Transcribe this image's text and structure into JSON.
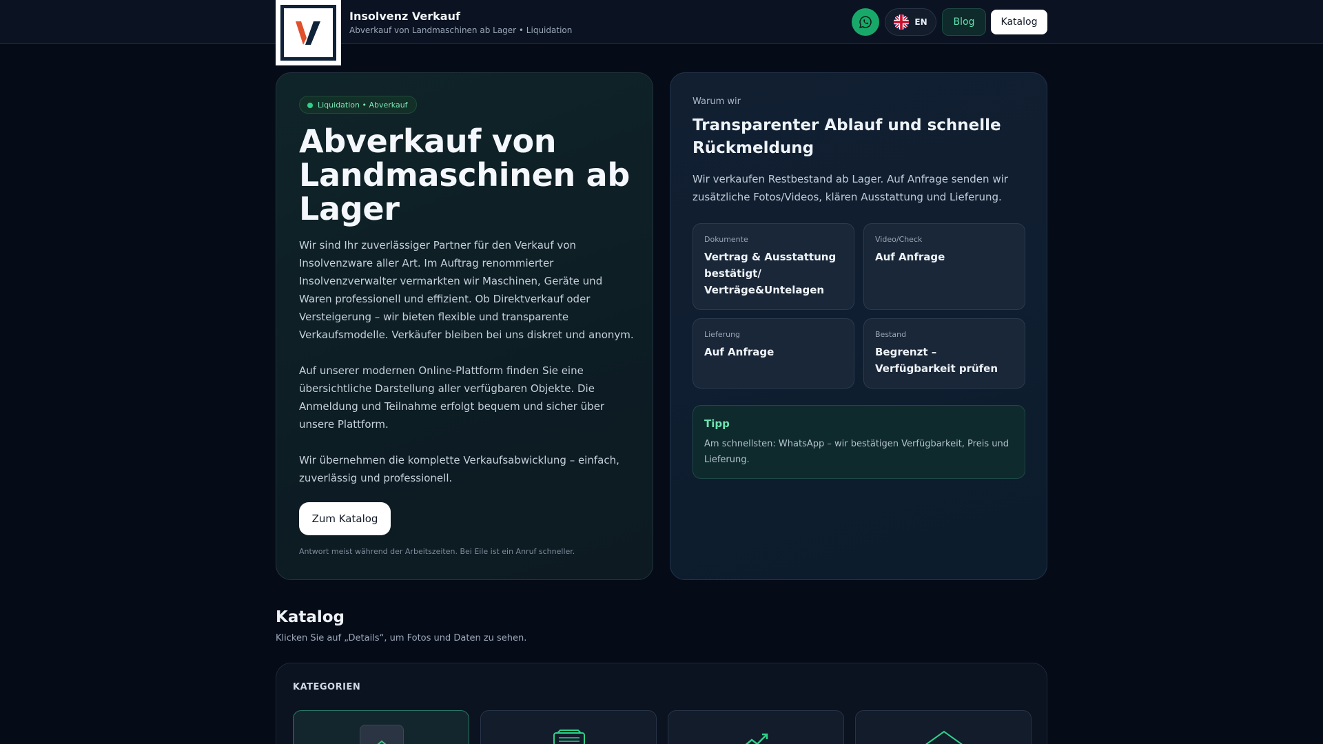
{
  "header": {
    "brand_title": "Insolvenz Verkauf",
    "brand_subtitle": "Abverkauf von Landmaschinen ab Lager • Liquidation",
    "logo_letter": "V",
    "whatsapp_icon": "whatsapp-icon",
    "lang_label": "EN",
    "lang_flag_icon": "uk-flag-icon",
    "blog_label": "Blog",
    "katalog_label": "Katalog"
  },
  "hero": {
    "badge": "Liquidation • Abverkauf",
    "title": "Abverkauf von Landmaschinen ab Lager",
    "paragraphs": [
      "Wir sind Ihr zuverlässiger Partner für den Verkauf von Insolvenzware aller Art. Im Auftrag renommierter Insolvenzverwalter vermarkten wir Maschinen, Geräte und Waren professionell und effizient. Ob Direktverkauf oder Versteigerung – wir bieten flexible und transparente Verkaufsmodelle. Verkäufer bleiben bei uns diskret und anonym.",
      "Auf unserer modernen Online-Plattform finden Sie eine übersichtliche Darstellung aller verfügbaren Objekte. Die Anmeldung und Teilnahme erfolgt bequem und sicher über unsere Plattform.",
      "Wir übernehmen die komplette Verkaufsabwicklung – einfach, zuverlässig und professionell."
    ],
    "cta_label": "Zum Katalog",
    "note": "Antwort meist während der Arbeitszeiten. Bei Eile ist ein Anruf schneller."
  },
  "why": {
    "kicker": "Warum wir",
    "title": "Transparenter Ablauf und schnelle Rückmeldung",
    "text": "Wir verkaufen Restbestand ab Lager. Auf Anfrage senden wir zusätzliche Fotos/Videos, klären Ausstattung und Lieferung.",
    "tiles": [
      {
        "label": "Dokumente",
        "value": "Vertrag & Ausstattung bestätigt/ Verträge&Untelagen"
      },
      {
        "label": "Video/Check",
        "value": "Auf Anfrage"
      },
      {
        "label": "Lieferung",
        "value": "Auf Anfrage"
      },
      {
        "label": "Bestand",
        "value": "Begrenzt – Verfügbarkeit prüfen"
      }
    ],
    "tipp_title": "Tipp",
    "tipp_text": "Am schnellsten: WhatsApp – wir bestätigen Verfügbarkeit, Preis und Lieferung."
  },
  "katalog": {
    "title": "Katalog",
    "subtitle": "Klicken Sie auf „Details“, um Fotos und Daten zu sehen.",
    "categories_heading": "KATEGORIEN",
    "category_icons": [
      "home-icon",
      "tractor-icon",
      "chart-icon",
      "roof-icon"
    ]
  },
  "colors": {
    "background": "#060b18",
    "accent_green": "#2fd089",
    "whatsapp_green": "#18a96a",
    "logo_orange": "#e0502a",
    "logo_navy": "#0f2238"
  }
}
